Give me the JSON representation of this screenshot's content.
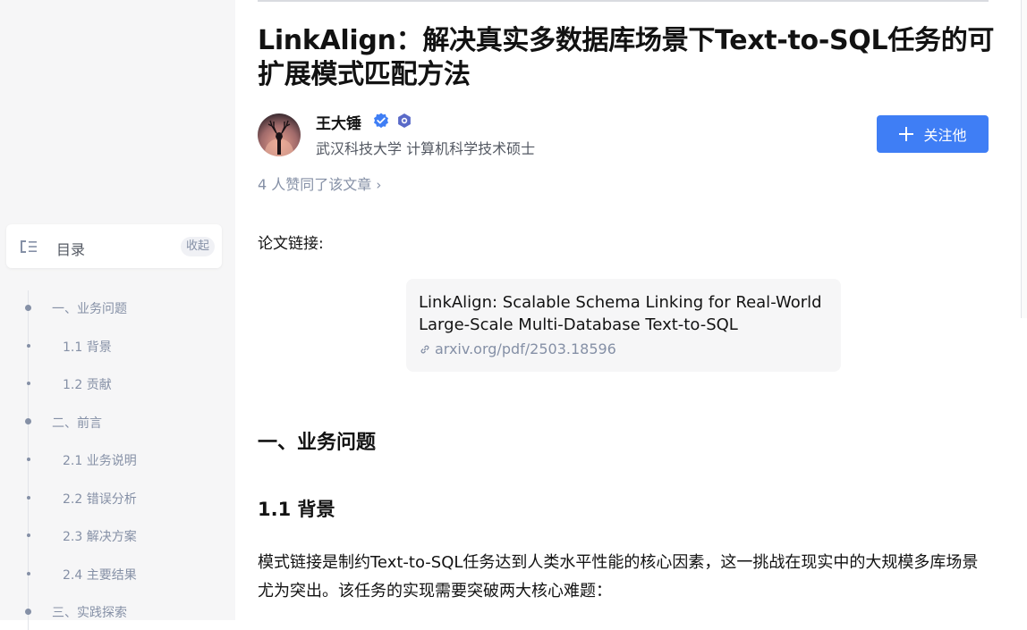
{
  "toc": {
    "title": "目录",
    "collapse_label": "收起",
    "items": [
      {
        "label": "一、业务问题",
        "level": 1
      },
      {
        "label": "1.1 背景",
        "level": 2
      },
      {
        "label": "1.2 贡献",
        "level": 2
      },
      {
        "label": "二、前言",
        "level": 1
      },
      {
        "label": "2.1 业务说明",
        "level": 2
      },
      {
        "label": "2.2 错误分析",
        "level": 2
      },
      {
        "label": "2.3 解决方案",
        "level": 2
      },
      {
        "label": "2.4 主要结果",
        "level": 2
      },
      {
        "label": "三、实践探索",
        "level": 1
      }
    ]
  },
  "article": {
    "title": "LinkAlign：解决真实多数据库场景下Text-to-SQL任务的可扩展模式匹配方法",
    "author": {
      "name": "王大锤",
      "bio": "武汉科技大学 计算机科学技术硕士",
      "avatar_icon": "deer-silhouette-avatar"
    },
    "follow_label": "关注他",
    "likes_text": "4 人赞同了该文章",
    "paper_label": "论文链接:",
    "link_card": {
      "title": "LinkAlign: Scalable Schema Linking for Real-World Large-Scale Multi-Database Text-to-SQL",
      "url": "arxiv.org/pdf/2503.18596"
    },
    "h2": "一、业务问题",
    "h3": "1.1 背景",
    "paragraph": "模式链接是制约Text-to-SQL任务达到人类水平性能的核心因素，这一挑战在现实中的大规模多库场景尤为突出。该任务的实现需要突破两大核心难题："
  },
  "colors": {
    "accent": "#3f7ef5",
    "muted": "#8590a6",
    "sidebar_bg": "#f6f6f7"
  }
}
